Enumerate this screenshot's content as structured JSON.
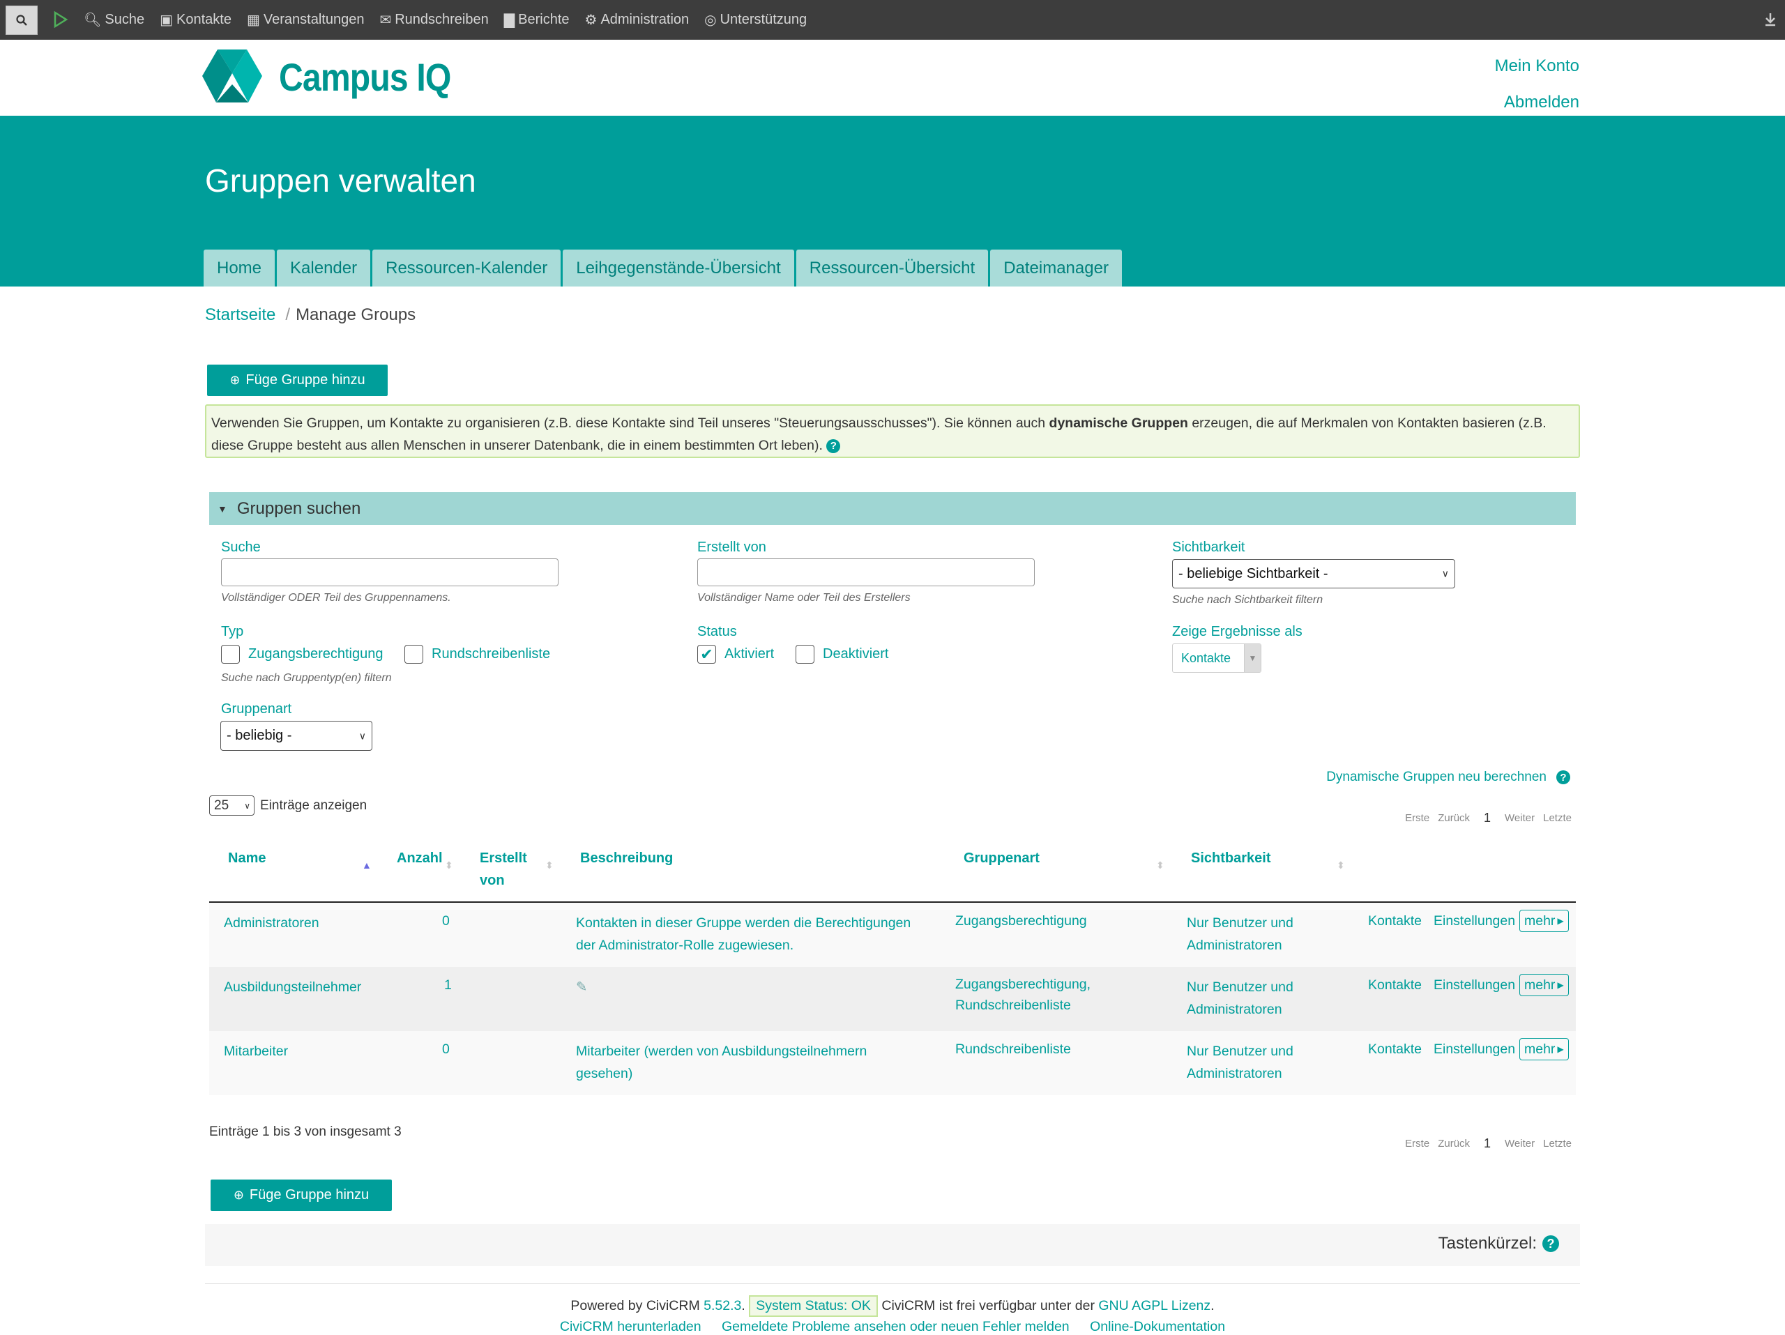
{
  "topbar": {
    "items": [
      "Suche",
      "Kontakte",
      "Veranstaltungen",
      "Rundschreiben",
      "Berichte",
      "Administration",
      "Unterstützung"
    ]
  },
  "brand": {
    "name": "Campus IQ"
  },
  "account": {
    "my_account": "Mein Konto",
    "logout": "Abmelden"
  },
  "page": {
    "title": "Gruppen verwalten"
  },
  "tabs": [
    "Home",
    "Kalender",
    "Ressourcen-Kalender",
    "Leihgegenstände-Übersicht",
    "Ressourcen-Übersicht",
    "Dateimanager"
  ],
  "breadcrumb": {
    "home": "Startseite",
    "sep": "/",
    "current": "Manage Groups"
  },
  "add_group_label": "Füge Gruppe hinzu",
  "help": {
    "text_before": "Verwenden Sie Gruppen, um Kontakte zu organisieren (z.B. diese Kontakte sind Teil unseres \"Steuerungsausschusses\"). Sie können auch ",
    "bold": "dynamische Gruppen",
    "text_after": " erzeugen, die auf Merkmalen von Kontakten basieren (z.B. diese Gruppe besteht aus allen Menschen in unserer Datenbank, die in einem bestimmten Ort leben)."
  },
  "search": {
    "header": "Gruppen suchen",
    "suche_label": "Suche",
    "suche_desc": "Vollständiger ODER Teil des Gruppennamens.",
    "suche_value": "",
    "creator_label": "Erstellt von",
    "creator_desc": "Vollständiger Name oder Teil des Erstellers",
    "creator_value": "",
    "visibility_label": "Sichtbarkeit",
    "visibility_value": "- beliebige Sichtbarkeit -",
    "visibility_desc": "Suche nach Sichtbarkeit filtern",
    "type_label": "Typ",
    "type_options": [
      {
        "label": "Zugangsberechtigung",
        "checked": false
      },
      {
        "label": "Rundschreibenliste",
        "checked": false
      }
    ],
    "type_desc": "Suche nach Gruppentyp(en) filtern",
    "status_label": "Status",
    "status_options": [
      {
        "label": "Aktiviert",
        "checked": true
      },
      {
        "label": "Deaktiviert",
        "checked": false
      }
    ],
    "show_as_label": "Zeige Ergebnisse als",
    "show_as_value": "Kontakte",
    "grouptype_label": "Gruppenart",
    "grouptype_value": "- beliebig -"
  },
  "results": {
    "recalc": "Dynamische Gruppen neu berechnen",
    "page_length": "25",
    "page_length_label": "Einträge anzeigen",
    "pager": {
      "first": "Erste",
      "prev": "Zurück",
      "page": "1",
      "next": "Weiter",
      "last": "Letzte"
    },
    "columns": {
      "name": "Name",
      "count": "Anzahl",
      "created_by": "Erstellt von",
      "description": "Beschreibung",
      "group_type": "Gruppenart",
      "visibility": "Sichtbarkeit"
    },
    "rows": [
      {
        "name": "Administratoren",
        "count": "0",
        "created_by": "",
        "description": "Kontakten in dieser Gruppe werden die Berechtigungen der Administrator-Rolle zugewiesen.",
        "group_type": "Zugangsberechtigung",
        "visibility": "Nur Benutzer und Administratoren",
        "actions": [
          "Kontakte",
          "Einstellungen",
          "mehr"
        ]
      },
      {
        "name": "Ausbildungsteilnehmer",
        "count": "1",
        "created_by": "",
        "description": "",
        "group_type": "Zugangsberechtigung, Rundschreibenliste",
        "visibility": "Nur Benutzer und Administratoren",
        "actions": [
          "Kontakte",
          "Einstellungen",
          "mehr"
        ]
      },
      {
        "name": "Mitarbeiter",
        "count": "0",
        "created_by": "",
        "description": "Mitarbeiter (werden von Ausbildungsteilnehmern gesehen)",
        "group_type": "Rundschreibenliste",
        "visibility": "Nur Benutzer und Administratoren",
        "actions": [
          "Kontakte",
          "Einstellungen",
          "mehr"
        ]
      }
    ],
    "count_text": "Einträge 1 bis 3 von insgesamt 3"
  },
  "shortcuts": {
    "label": "Tastenkürzel:"
  },
  "footer": {
    "powered": "Powered by CiviCRM",
    "version": "5.52.3",
    "status": "System Status: OK",
    "license_text": "CiviCRM ist frei verfügbar unter der",
    "license_link": "GNU AGPL Lizenz",
    "links": [
      "CiviCRM herunterladen",
      "Gemeldete Probleme ansehen oder neuen Fehler melden",
      "Online-Dokumentation"
    ]
  },
  "colors": {
    "accent": "#009e9a",
    "tab": "#a9dcd9",
    "help_bg": "#f2f8e6",
    "help_border": "#c5e59a"
  }
}
